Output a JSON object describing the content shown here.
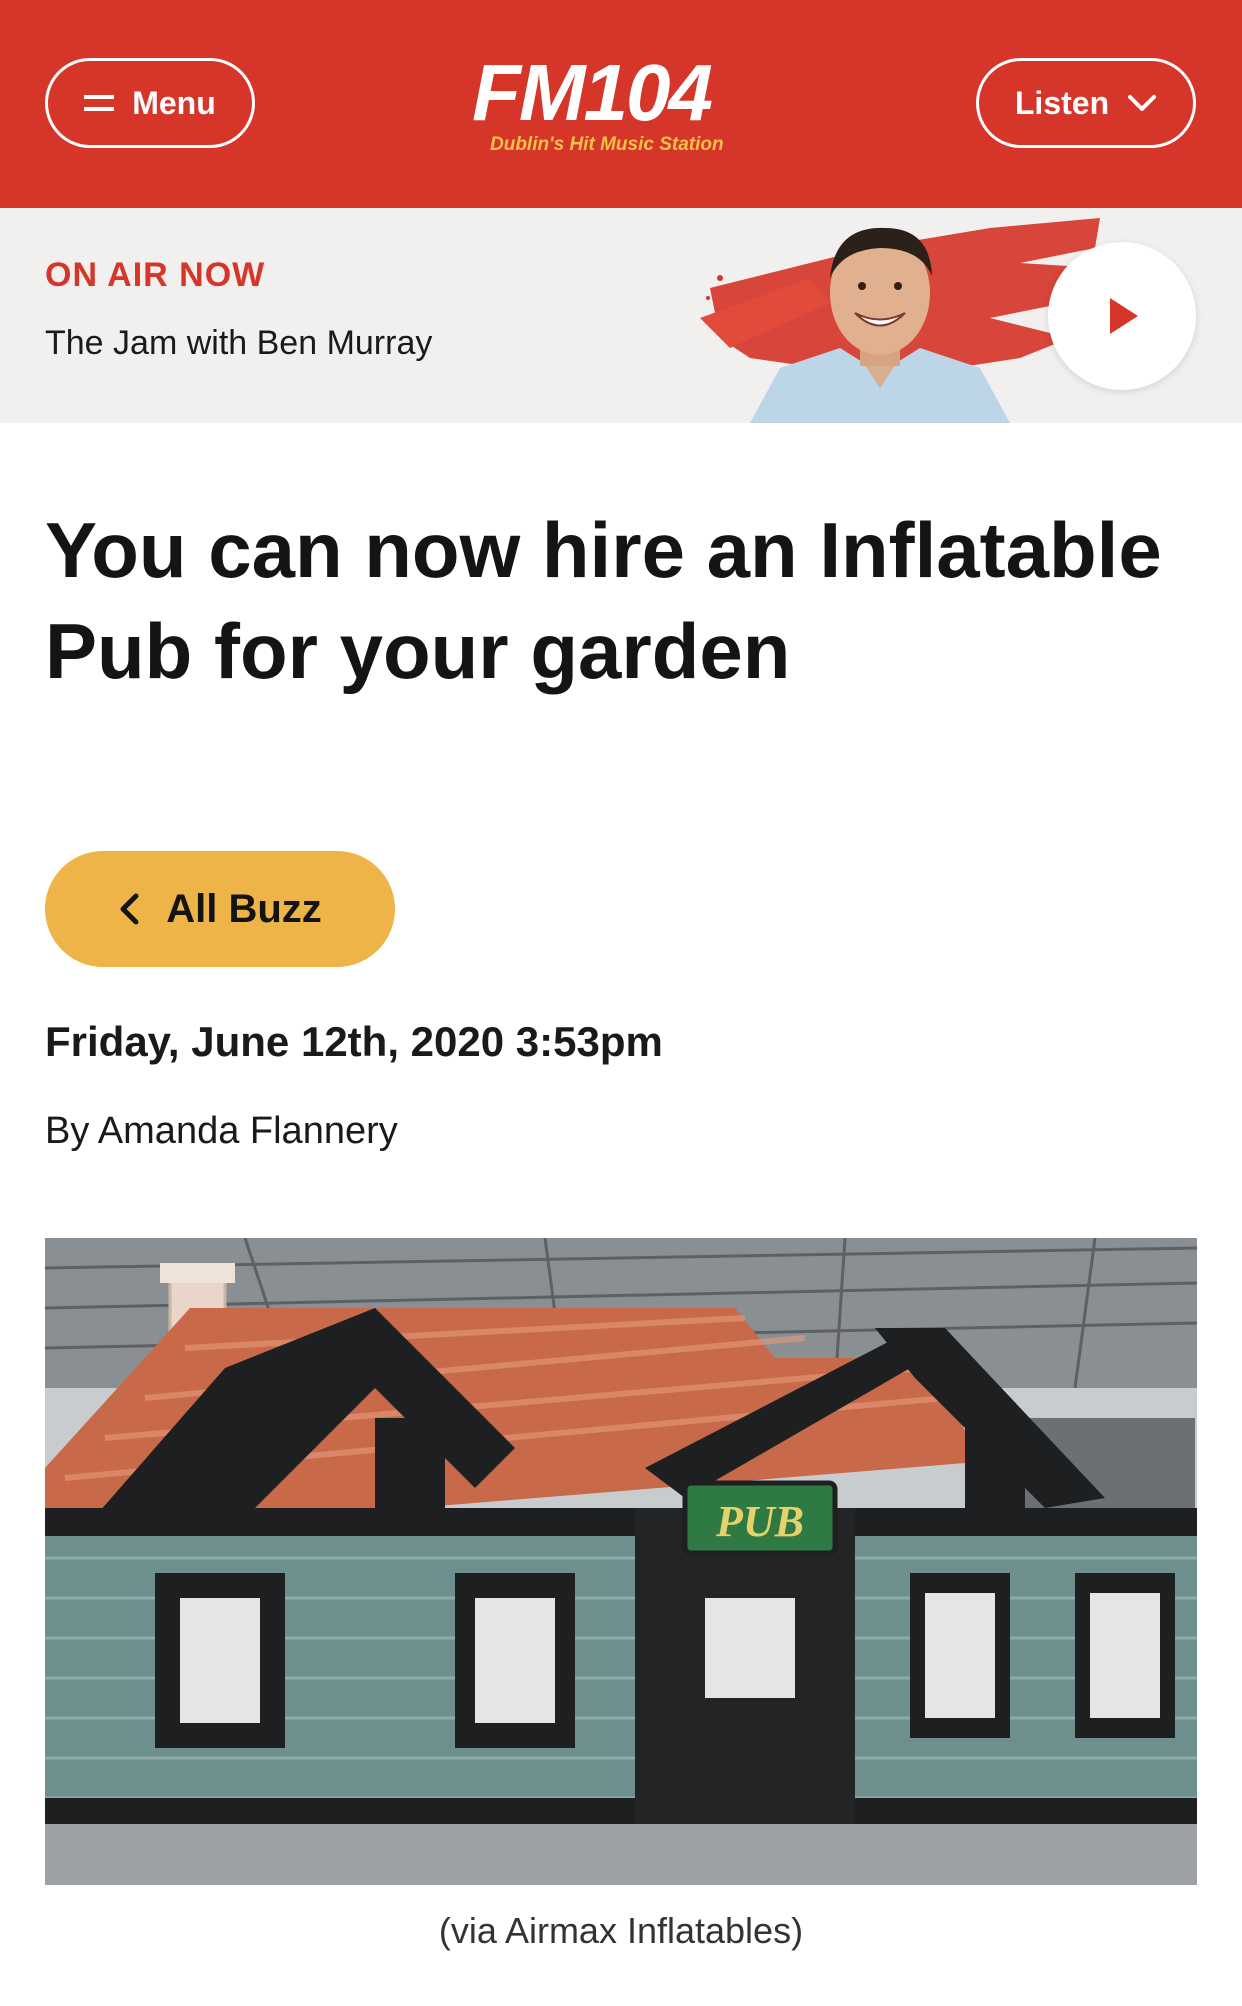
{
  "colors": {
    "brand_red": "#d6362a",
    "onair_bg": "#f1f0ef",
    "button_yellow": "#efb447",
    "logo_tagline": "#f6c04a"
  },
  "header": {
    "menu_label": "Menu",
    "menu_icon": "hamburger-icon",
    "listen_label": "Listen",
    "listen_icon": "chevron-down-icon",
    "logo": {
      "text": "FM104",
      "tagline": "Dublin's Hit Music Station"
    }
  },
  "on_air": {
    "label": "ON AIR NOW",
    "show": "The Jam with Ben Murray",
    "play_icon": "play-icon"
  },
  "article": {
    "title": "You can now hire an Inflatable Pub for your garden",
    "back_button_label": "All Buzz",
    "back_icon": "chevron-left-icon",
    "date": "Friday, June 12th, 2020 3:53pm",
    "byline": "By Amanda Flannery",
    "image": {
      "sign_text": "PUB",
      "caption": "(via Airmax Inflatables)"
    }
  }
}
